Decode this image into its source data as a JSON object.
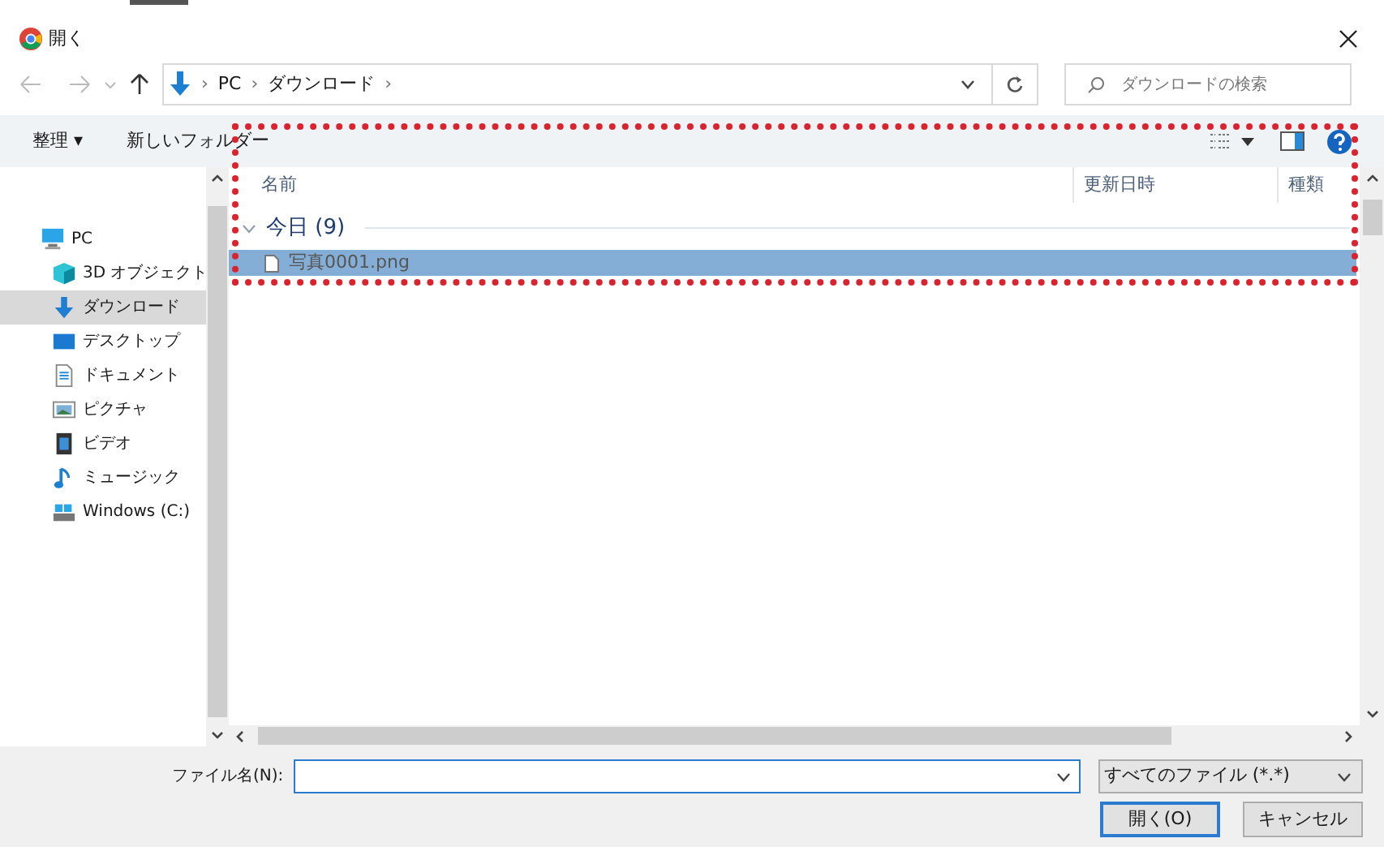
{
  "window": {
    "title": "開く"
  },
  "nav": {
    "path": [
      {
        "kind": "separator",
        "text": "›"
      },
      {
        "kind": "folder",
        "text": "PC"
      },
      {
        "kind": "separator",
        "text": "›"
      },
      {
        "kind": "folder",
        "text": "ダウンロード"
      },
      {
        "kind": "separator",
        "text": "›"
      }
    ],
    "search_placeholder": "ダウンロードの検索"
  },
  "toolbar": {
    "organize": "整理 ▾",
    "new_folder": "新しいフォルダー"
  },
  "sidebar": {
    "items": [
      {
        "label": "PC",
        "kind": "pc",
        "selected": false,
        "children": [
          {
            "label": "3D オブジェクト",
            "kind": "cube",
            "selected": false
          },
          {
            "label": "ダウンロード",
            "kind": "download",
            "selected": true
          },
          {
            "label": "デスクトップ",
            "kind": "desktop",
            "selected": false
          },
          {
            "label": "ドキュメント",
            "kind": "document",
            "selected": false
          },
          {
            "label": "ピクチャ",
            "kind": "picture",
            "selected": false
          },
          {
            "label": "ビデオ",
            "kind": "video",
            "selected": false
          },
          {
            "label": "ミュージック",
            "kind": "music",
            "selected": false
          },
          {
            "label": "Windows (C:)",
            "kind": "drive",
            "selected": false
          }
        ]
      }
    ]
  },
  "table": {
    "columns": [
      "名前",
      "更新日時",
      "種類"
    ],
    "groups": [
      {
        "label": "今日 (9)",
        "expanded": true,
        "rows": [
          {
            "name": "写真0001.png",
            "selected": true
          }
        ]
      }
    ]
  },
  "bottom": {
    "filename_label": "ファイル名(N):",
    "filetype": "すべてのファイル (*.*)",
    "open": "開く(O)",
    "cancel": "キャンセル"
  }
}
